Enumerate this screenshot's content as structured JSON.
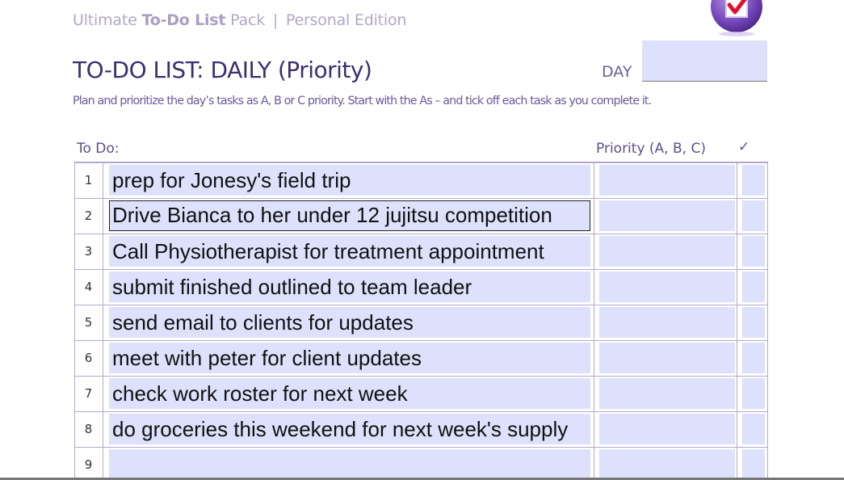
{
  "header": {
    "brand_prefix": "Ultimate ",
    "brand_bold": "To-Do List",
    "brand_suffix": " Pack",
    "brand_separator": "|",
    "brand_edition": "Personal Edition",
    "logo_icon": "checkbox-tick-icon",
    "title": "TO-DO LIST: DAILY (Priority)",
    "day_label": "DAY",
    "day_value": "",
    "instructions": "Plan and prioritize the day’s tasks as A, B or C priority. Start with the As – and tick off each task as you complete it."
  },
  "columns": {
    "todo": "To Do:",
    "priority": "Priority (A, B, C)",
    "done": "✓"
  },
  "rows": [
    {
      "number": "1",
      "task": "prep for Jonesy's field trip",
      "priority": "",
      "done": ""
    },
    {
      "number": "2",
      "task": "Drive Bianca to her under 12 jujitsu competition",
      "priority": "",
      "done": ""
    },
    {
      "number": "3",
      "task": "Call Physiotherapist for treatment appointment",
      "priority": "",
      "done": ""
    },
    {
      "number": "4",
      "task": "submit finished outlined to team leader",
      "priority": "",
      "done": ""
    },
    {
      "number": "5",
      "task": "send email to clients for updates",
      "priority": "",
      "done": ""
    },
    {
      "number": "6",
      "task": "meet with peter for client updates",
      "priority": "",
      "done": ""
    },
    {
      "number": "7",
      "task": "check work roster for next week",
      "priority": "",
      "done": ""
    },
    {
      "number": "8",
      "task": "do groceries this weekend for next week's supply",
      "priority": "",
      "done": ""
    },
    {
      "number": "9",
      "task": "",
      "priority": "",
      "done": ""
    }
  ],
  "colors": {
    "field_fill": "#dde1fb",
    "brand_text": "#b1a8c6",
    "title_text": "#3d2e6e",
    "table_border": "#b3a9cf",
    "logo_check": "#e0102a",
    "logo_circle": "#6a3fa8"
  }
}
